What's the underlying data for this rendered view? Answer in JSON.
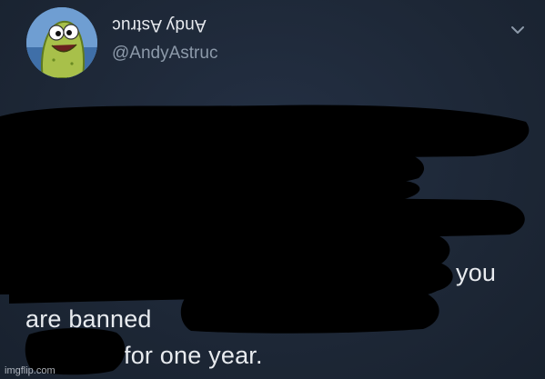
{
  "tweet": {
    "display_name": "Andy Astruc",
    "handle": "@AndyAstruc",
    "text_fragments": {
      "you": "you",
      "are_banned": "are banned",
      "for_one_year": "for one year."
    }
  },
  "icons": {
    "avatar": "cartoon-pickle-avatar",
    "menu": "chevron-down-icon"
  },
  "watermark": "imgflip.com",
  "colors": {
    "background": "#1e2837",
    "text": "#e8ebef",
    "handle": "#8d9aaa",
    "redaction": "#000000"
  }
}
